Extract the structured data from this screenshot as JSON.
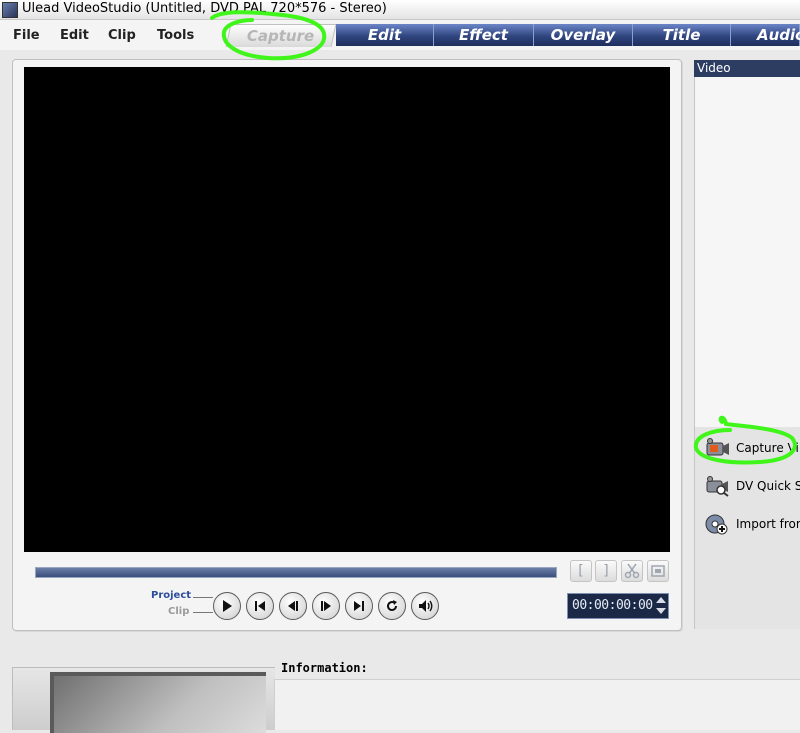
{
  "window": {
    "title": "Ulead VideoStudio (Untitled, DVD PAL 720*576 - Stereo)"
  },
  "menu": {
    "file": "File",
    "edit": "Edit",
    "clip": "Clip",
    "tools": "Tools"
  },
  "tabs": {
    "capture": "Capture",
    "edit": "Edit",
    "effect": "Effect",
    "overlay": "Overlay",
    "title": "Title",
    "audio": "Audio"
  },
  "player": {
    "project_label": "Project",
    "clip_label": "Clip",
    "timecode": "00:00:00:00",
    "mark_in_label": "[",
    "mark_out_label": "]"
  },
  "options_panel": {
    "header": "Video",
    "items": [
      {
        "label": "Capture Vi",
        "icon": "camcorder-capture-icon"
      },
      {
        "label": "DV Quick S",
        "icon": "camcorder-scan-icon"
      },
      {
        "label": "Import from",
        "icon": "disc-import-icon"
      }
    ]
  },
  "info": {
    "label": "Information:"
  },
  "annotations": {
    "color": "#3ff51a"
  }
}
